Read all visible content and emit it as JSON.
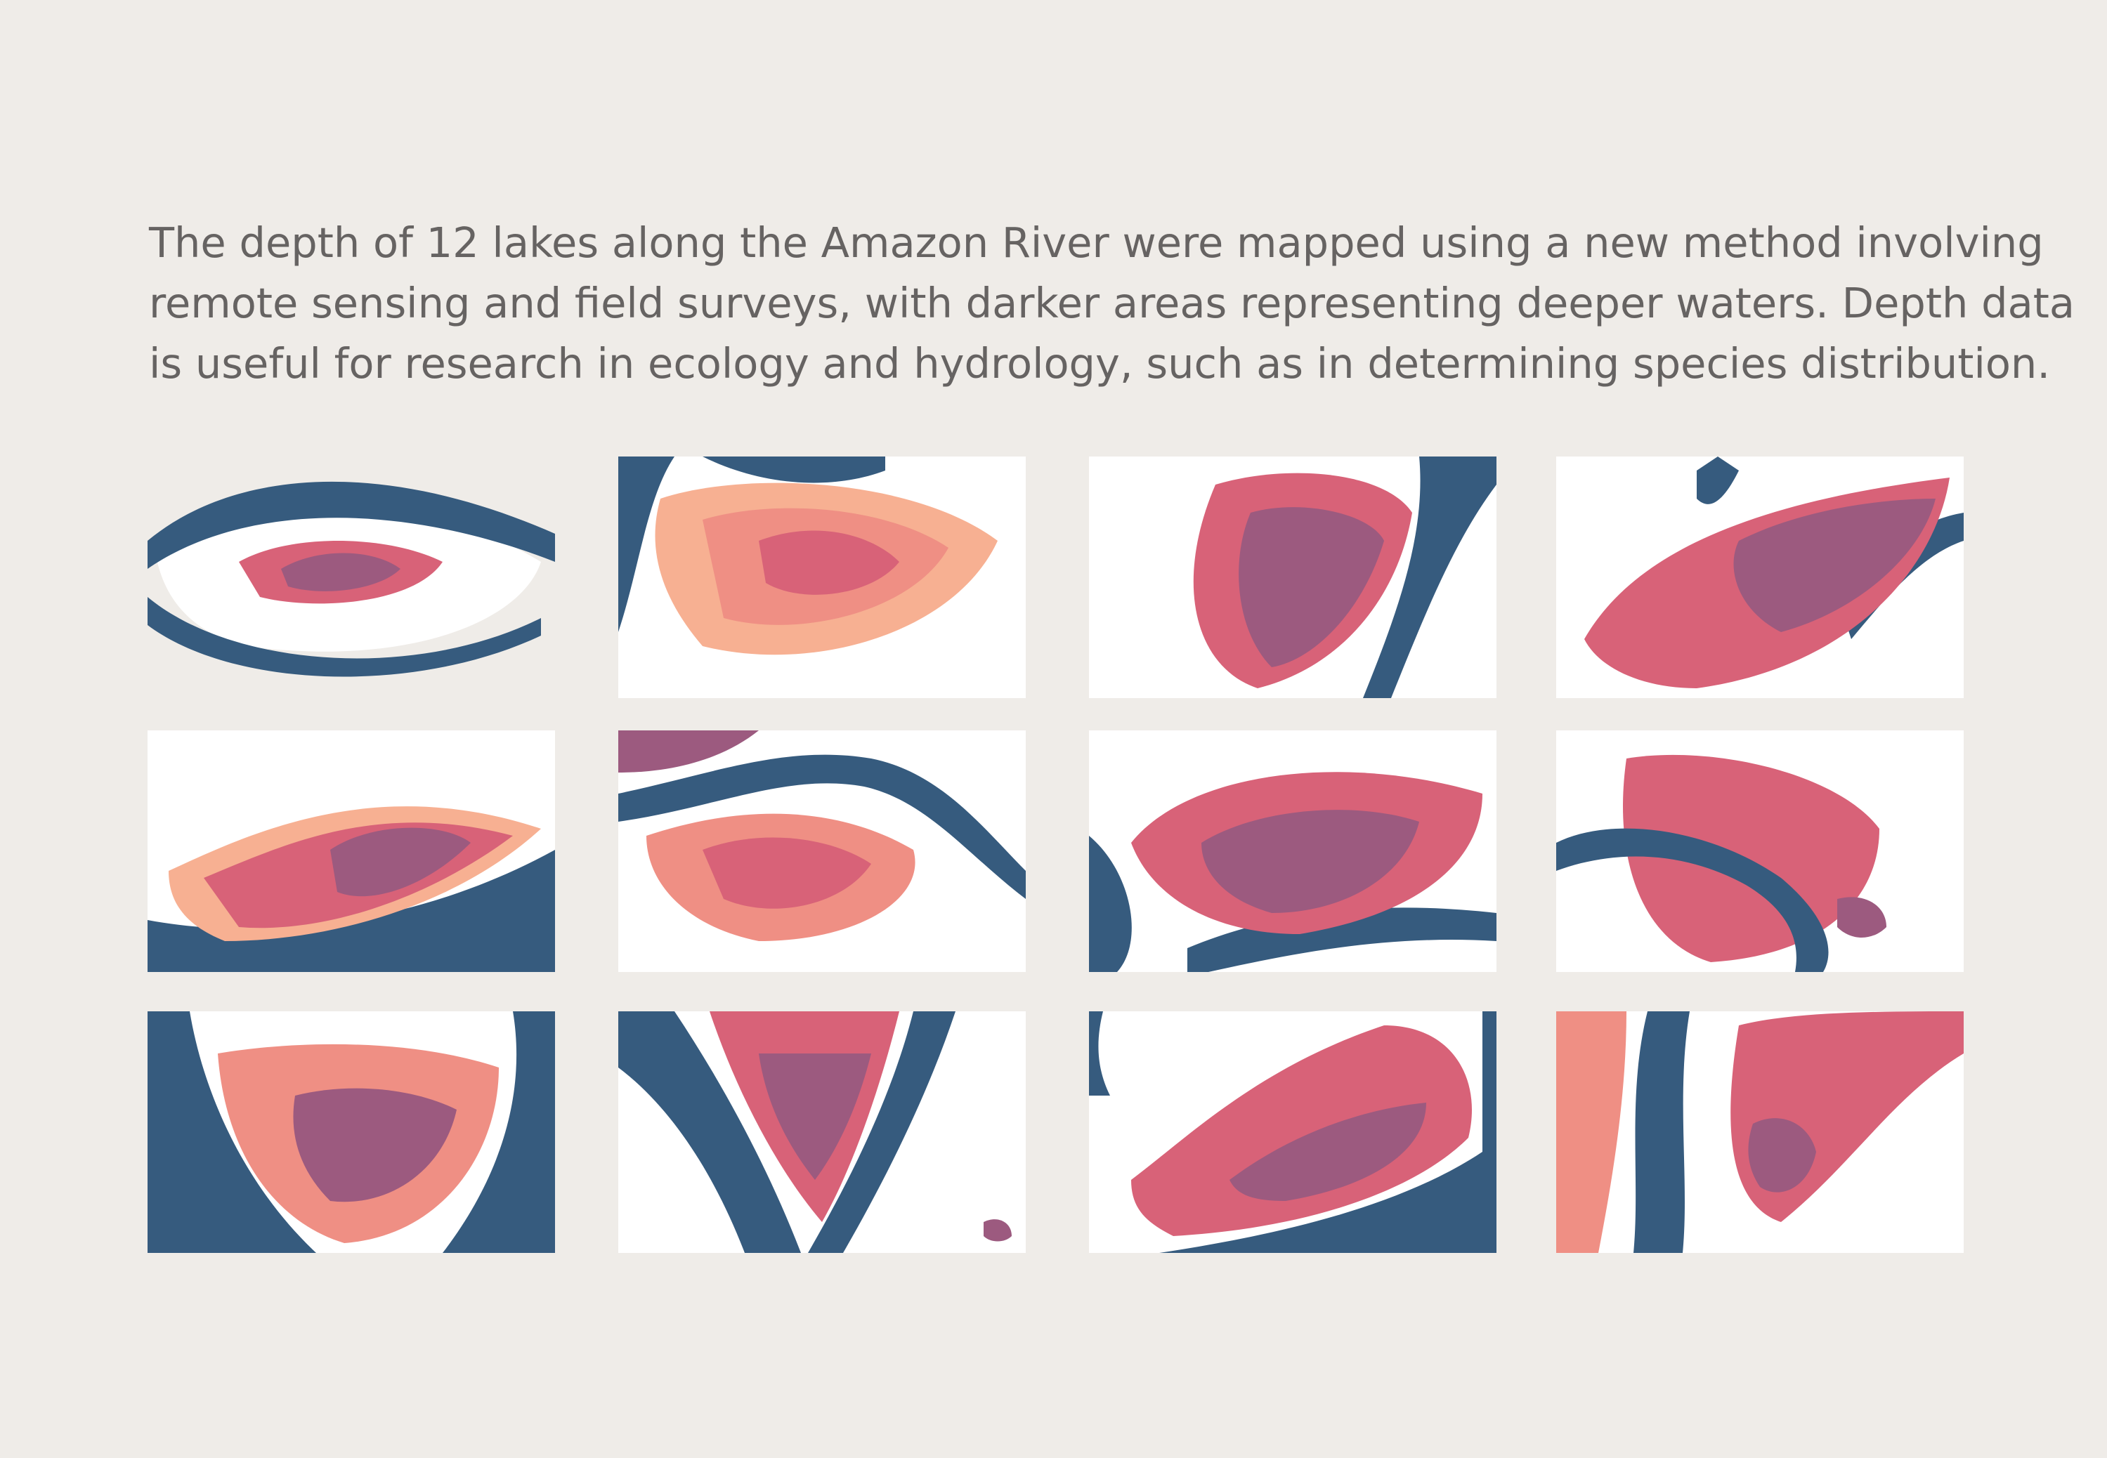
{
  "caption": {
    "lines": [
      "The depth of 12 lakes along the Amazon River were mapped using a new method involving",
      "remote sensing and field surveys, with darker areas representing deeper waters. Depth data",
      "is useful for research in ecology and hydrology, such as in determining species distribution."
    ]
  },
  "colors": {
    "background": "#efece8",
    "text": "#666362",
    "river": "#365b7e",
    "land": "#ffffff",
    "depth_shallow": "#f7b092",
    "depth_mid_light": "#ef8f84",
    "depth_mid": "#d86278",
    "depth_deep": "#9c5a7f"
  },
  "grid": {
    "rows": 3,
    "columns": 4
  },
  "lakes": [
    {
      "id": 1
    },
    {
      "id": 2
    },
    {
      "id": 3
    },
    {
      "id": 4
    },
    {
      "id": 5
    },
    {
      "id": 6
    },
    {
      "id": 7
    },
    {
      "id": 8
    },
    {
      "id": 9
    },
    {
      "id": 10
    },
    {
      "id": 11
    },
    {
      "id": 12
    }
  ]
}
